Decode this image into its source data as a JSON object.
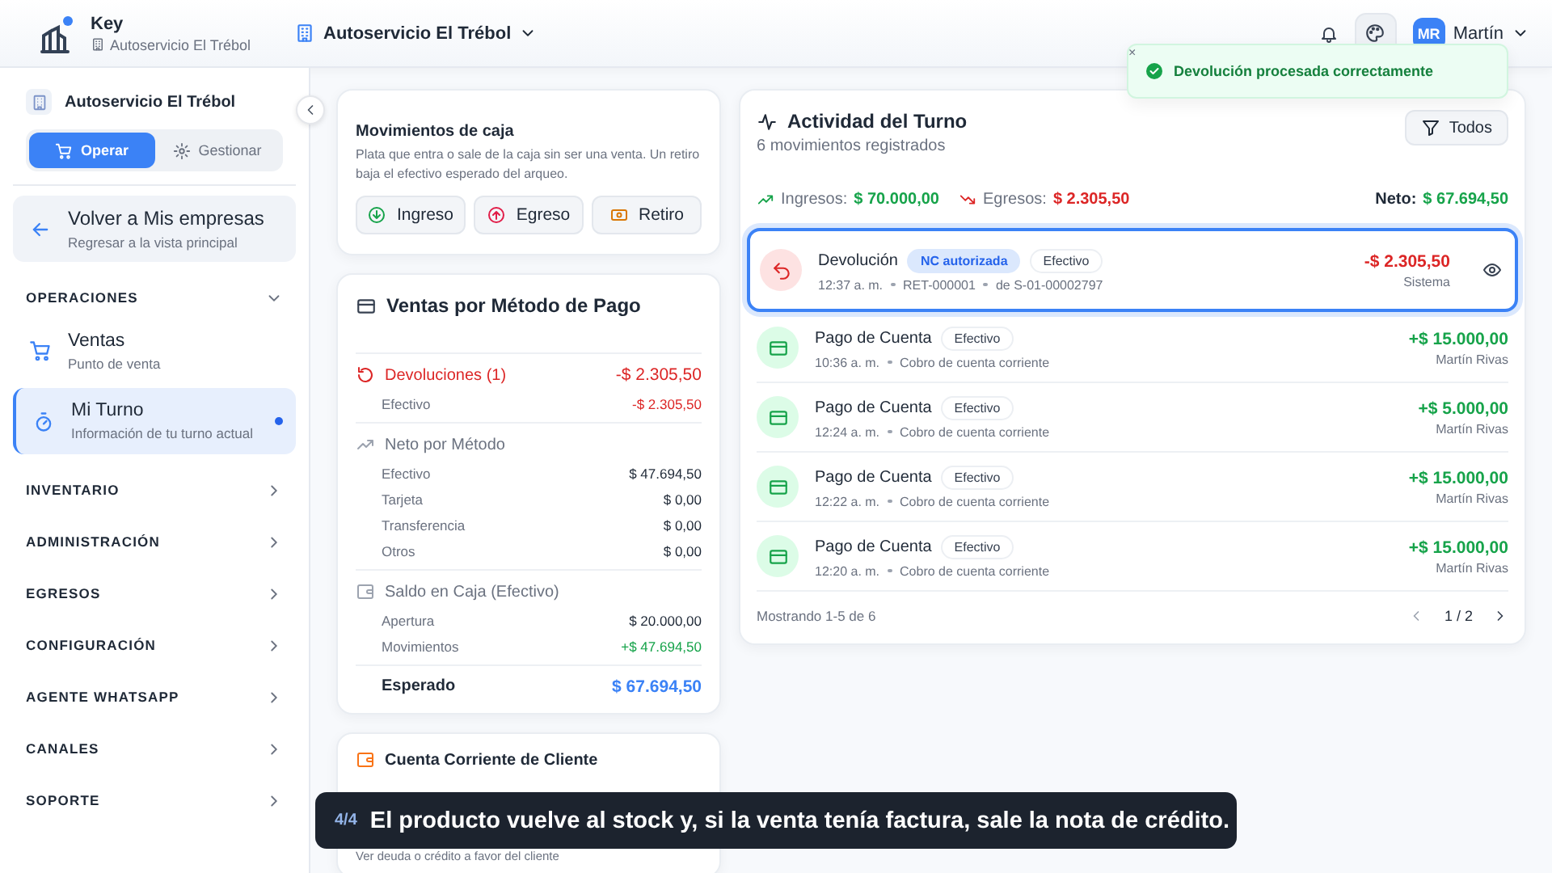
{
  "header": {
    "brand": {
      "title": "Key",
      "subtitle": "Autoservicio El Trébol"
    },
    "store_selector": "Autoservicio El Trébol",
    "user": {
      "initials": "MR",
      "name": "Martín"
    }
  },
  "toast": {
    "close": "×",
    "message": "Devolución procesada correctamente"
  },
  "sidebar": {
    "store": "Autoservicio El Trébol",
    "modes": [
      {
        "label": "Operar",
        "selected": true
      },
      {
        "label": "Gestionar",
        "selected": false
      }
    ],
    "back": {
      "title": "Volver a Mis empresas",
      "subtitle": "Regresar a la vista principal"
    },
    "sections": [
      {
        "title": "OPERACIONES",
        "expanded": true,
        "items": [
          {
            "title": "Ventas",
            "subtitle": "Punto de venta",
            "selected": false
          },
          {
            "title": "Mi Turno",
            "subtitle": "Información de tu turno actual",
            "selected": true
          }
        ]
      },
      {
        "title": "INVENTARIO",
        "expanded": false
      },
      {
        "title": "ADMINISTRACIÓN",
        "expanded": false
      },
      {
        "title": "EGRESOS",
        "expanded": false
      },
      {
        "title": "CONFIGURACIÓN",
        "expanded": false
      },
      {
        "title": "AGENTE WHATSAPP",
        "expanded": false
      },
      {
        "title": "CANALES",
        "expanded": false
      },
      {
        "title": "SOPORTE",
        "expanded": false
      }
    ]
  },
  "cash_movements": {
    "title": "Movimientos de caja",
    "description": "Plata que entra o sale de la caja sin ser una venta. Un retiro baja el efectivo esperado del arqueo.",
    "buttons": [
      {
        "label": "Ingreso",
        "kind": "income"
      },
      {
        "label": "Egreso",
        "kind": "expense"
      },
      {
        "label": "Retiro",
        "kind": "withdrawal"
      }
    ]
  },
  "sales_by_method": {
    "title": "Ventas por Método de Pago",
    "groups": [
      {
        "kind": "returns",
        "label": "Devoluciones (1)",
        "amount": "-$ 2.305,50",
        "rows": [
          {
            "label": "Efectivo",
            "amount": "-$ 2.305,50"
          }
        ]
      },
      {
        "kind": "net",
        "label": "Neto por Método",
        "rows": [
          {
            "label": "Efectivo",
            "amount": "$ 47.694,50"
          },
          {
            "label": "Tarjeta",
            "amount": "$ 0,00"
          },
          {
            "label": "Transferencia",
            "amount": "$ 0,00"
          },
          {
            "label": "Otros",
            "amount": "$ 0,00"
          }
        ]
      },
      {
        "kind": "balance",
        "label": "Saldo en Caja (Efectivo)",
        "rows": [
          {
            "label": "Apertura",
            "amount": "$ 20.000,00"
          },
          {
            "label": "Movimientos",
            "amount": "+$ 47.694,50"
          }
        ]
      }
    ],
    "expected": {
      "label": "Esperado",
      "amount": "$ 67.694,50"
    }
  },
  "customer_account": {
    "title": "Cuenta Corriente de Cliente",
    "description": "Ver deuda o crédito a favor del cliente"
  },
  "activity": {
    "title": "Actividad del Turno",
    "subtitle": "6 movimientos registrados",
    "filter": "Todos",
    "summary": {
      "income_label": "Ingresos:",
      "income": "$ 70.000,00",
      "expense_label": "Egresos:",
      "expense": "$ 2.305,50",
      "net_label": "Neto:",
      "net": "$ 67.694,50"
    },
    "entries": [
      {
        "kind": "refund",
        "title": "Devolución",
        "badges": [
          {
            "label": "NC autorizada",
            "kind": "info"
          },
          {
            "label": "Efectivo",
            "kind": "plain"
          }
        ],
        "details": [
          "12:37 a. m.",
          "RET-000001",
          "de S-01-00002797"
        ],
        "amount": "-$ 2.305,50",
        "by": "Sistema",
        "selected": true
      },
      {
        "kind": "payment",
        "title": "Pago de Cuenta",
        "badges": [
          {
            "label": "Efectivo",
            "kind": "plain"
          }
        ],
        "details": [
          "10:36 a. m.",
          "Cobro de cuenta corriente"
        ],
        "amount": "+$ 15.000,00",
        "by": "Martín Rivas",
        "selected": false
      },
      {
        "kind": "payment",
        "title": "Pago de Cuenta",
        "badges": [
          {
            "label": "Efectivo",
            "kind": "plain"
          }
        ],
        "details": [
          "12:24 a. m.",
          "Cobro de cuenta corriente"
        ],
        "amount": "+$ 5.000,00",
        "by": "Martín Rivas",
        "selected": false
      },
      {
        "kind": "payment",
        "title": "Pago de Cuenta",
        "badges": [
          {
            "label": "Efectivo",
            "kind": "plain"
          }
        ],
        "details": [
          "12:22 a. m.",
          "Cobro de cuenta corriente"
        ],
        "amount": "+$ 15.000,00",
        "by": "Martín Rivas",
        "selected": false
      },
      {
        "kind": "payment",
        "title": "Pago de Cuenta",
        "badges": [
          {
            "label": "Efectivo",
            "kind": "plain"
          }
        ],
        "details": [
          "12:20 a. m.",
          "Cobro de cuenta corriente"
        ],
        "amount": "+$ 15.000,00",
        "by": "Martín Rivas",
        "selected": false
      }
    ],
    "footer": "Mostrando 1-5 de 6",
    "page": "1 / 2"
  },
  "caption": {
    "step": "4/4",
    "text": "El producto vuelve al stock y, si la venta tenía factura, sale la nota de crédito."
  }
}
